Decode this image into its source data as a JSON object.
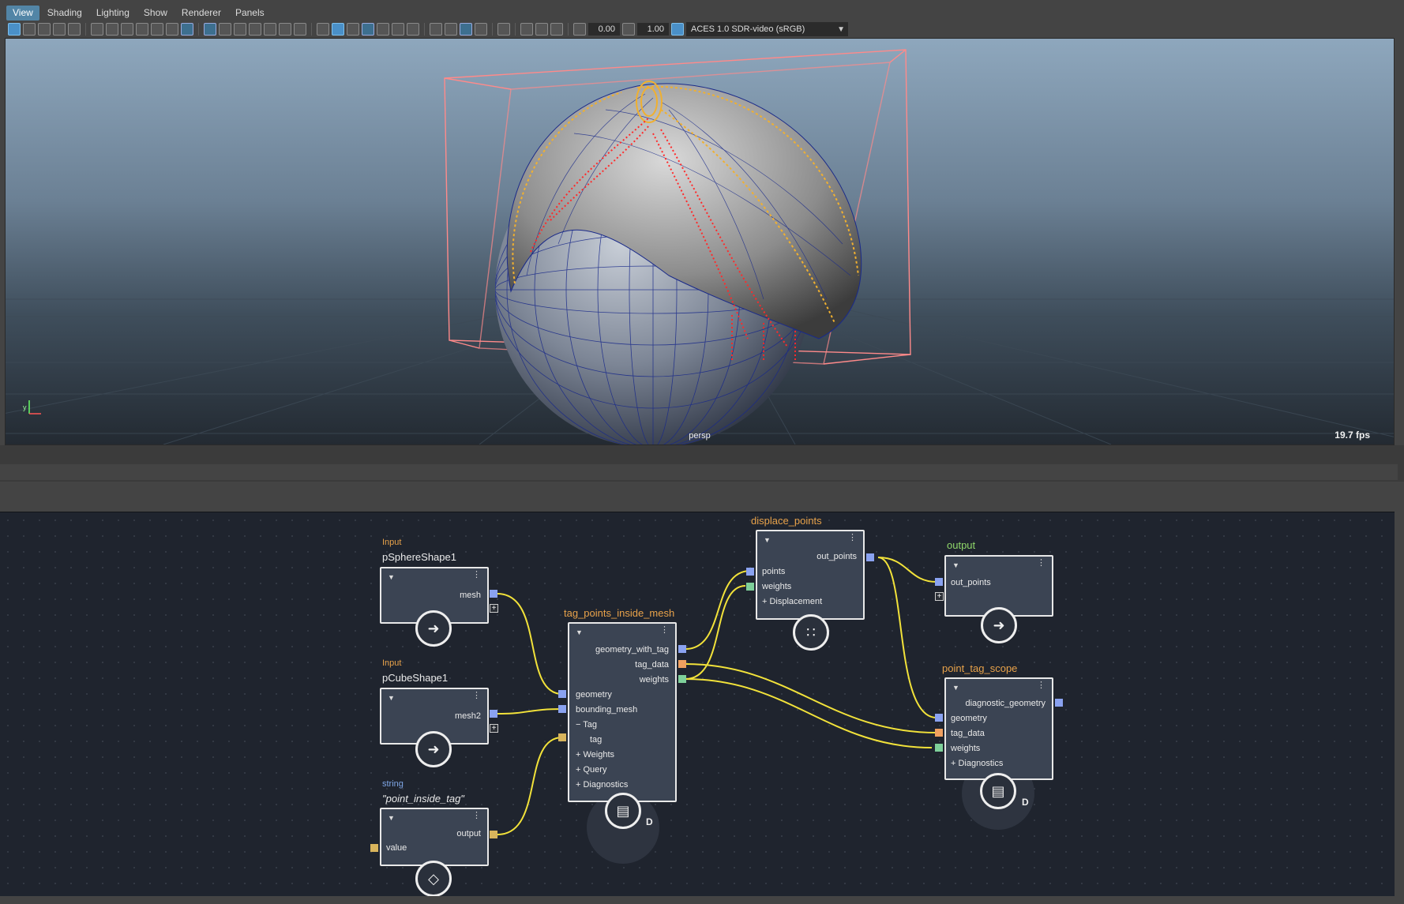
{
  "menu": [
    "View",
    "Shading",
    "Lighting",
    "Show",
    "Renderer",
    "Panels"
  ],
  "toolbar": {
    "exposure": "0.00",
    "gamma": "1.00",
    "color_transform": "ACES 1.0 SDR-video (sRGB)"
  },
  "viewport": {
    "camera": "persp",
    "fps": "19.7 fps",
    "axis_label": "y"
  },
  "nodes": {
    "sphere": {
      "category": "Input",
      "title": "pSphereShape1",
      "out": "mesh"
    },
    "cube": {
      "category": "Input",
      "title": "pCubeShape1",
      "out": "mesh2"
    },
    "string": {
      "category": "string",
      "title": "\"point_inside_tag\"",
      "out": "output",
      "in": "value"
    },
    "tag": {
      "title": "tag_points_inside_mesh",
      "outs": [
        "geometry_with_tag",
        "tag_data",
        "weights"
      ],
      "ins": [
        "geometry",
        "bounding_mesh"
      ],
      "group_tag": "Tag",
      "sub_tag": "tag",
      "groups": [
        "Weights",
        "Query",
        "Diagnostics"
      ],
      "badge_letter": "D"
    },
    "displace": {
      "title": "displace_points",
      "out": "out_points",
      "ins": [
        "points",
        "weights"
      ],
      "group": "Displacement"
    },
    "output": {
      "title": "output",
      "in": "out_points"
    },
    "scope": {
      "title": "point_tag_scope",
      "out": "diagnostic_geometry",
      "ins": [
        "geometry",
        "tag_data",
        "weights"
      ],
      "group": "Diagnostics",
      "badge_letter": "D"
    }
  },
  "colors": {
    "geometry_port": "#8aa2f0",
    "tag_port": "#f0a060",
    "weights_port": "#7ed09a",
    "string_port": "#d8b45c",
    "wire": "#f2e23a",
    "tag_points": "#ff2a2a",
    "scope_points": "#f0b030",
    "bbox": "#ff8a8a",
    "mesh_wire": "#1a2a8a"
  }
}
